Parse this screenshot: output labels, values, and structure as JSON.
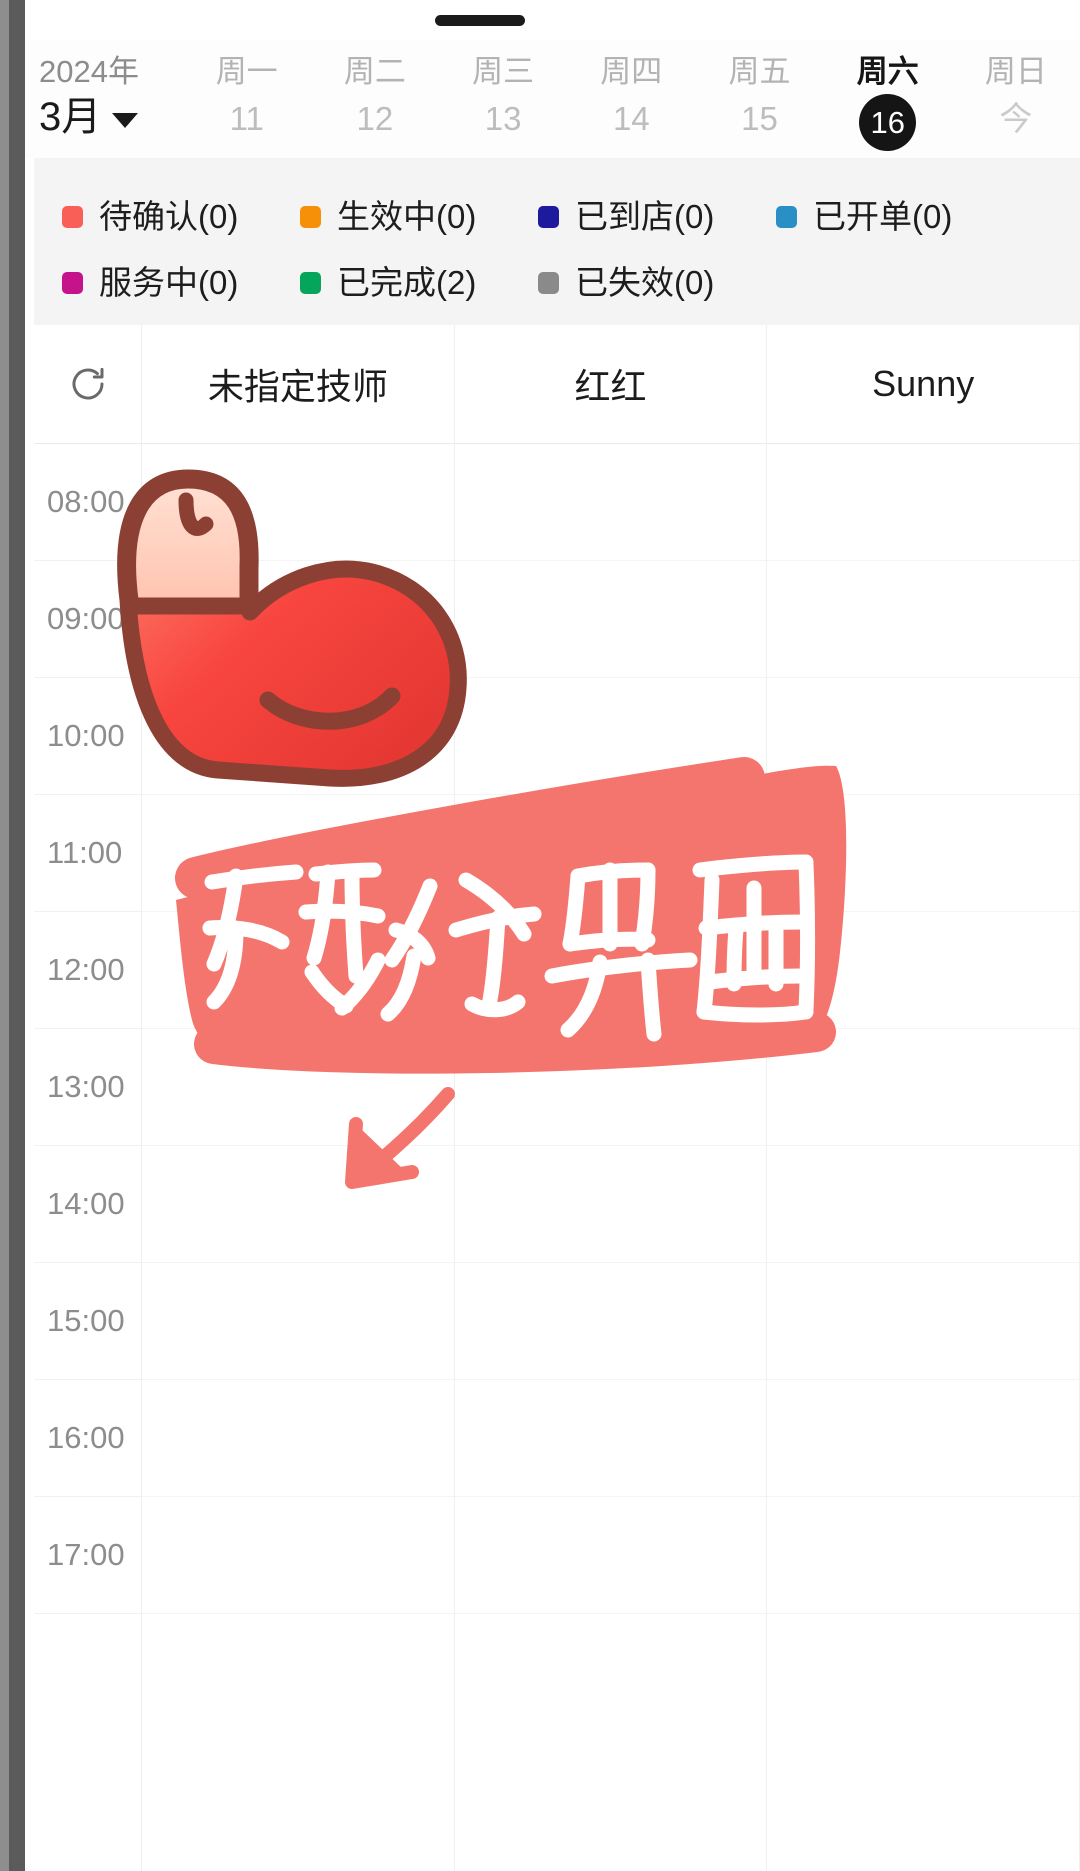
{
  "header": {
    "year": "2024年",
    "month": "3月",
    "caret_icon": "chevron-down-icon",
    "days": [
      {
        "dow": "周一",
        "num": "11",
        "active": false,
        "today": false
      },
      {
        "dow": "周二",
        "num": "12",
        "active": false,
        "today": false
      },
      {
        "dow": "周三",
        "num": "13",
        "active": false,
        "today": false
      },
      {
        "dow": "周四",
        "num": "14",
        "active": false,
        "today": false
      },
      {
        "dow": "周五",
        "num": "15",
        "active": false,
        "today": false
      },
      {
        "dow": "周六",
        "num": "16",
        "active": true,
        "today": true
      },
      {
        "dow": "周日",
        "num": "今",
        "active": false,
        "today": false
      }
    ]
  },
  "legend": {
    "row1": [
      {
        "label": "待确认(0)",
        "color": "#fa5f57"
      },
      {
        "label": "生效中(0)",
        "color": "#f79009"
      },
      {
        "label": "已到店(0)",
        "color": "#1e1a9e"
      },
      {
        "label": "已开单(0)",
        "color": "#2a8fc4"
      }
    ],
    "row2": [
      {
        "label": "服务中(0)",
        "color": "#c4138b"
      },
      {
        "label": "已完成(2)",
        "color": "#05a55b"
      },
      {
        "label": "已失效(0)",
        "color": "#8a8a8a"
      }
    ]
  },
  "grid": {
    "refresh_icon": "refresh-icon",
    "technicians": [
      "未指定技师",
      "红红",
      "Sunny"
    ],
    "times": [
      "08:00",
      "09:00",
      "10:00",
      "11:00",
      "12:00",
      "13:00",
      "14:00",
      "15:00",
      "16:00",
      "17:00"
    ]
  },
  "annotation": {
    "text": "预约界面",
    "highlight_color": "#f4756d",
    "text_color": "#ffffff",
    "sticker_icon": "flexed-biceps-emoji",
    "arrow_icon": "arrow-down-left-icon",
    "arrow_color": "#f4756d"
  }
}
